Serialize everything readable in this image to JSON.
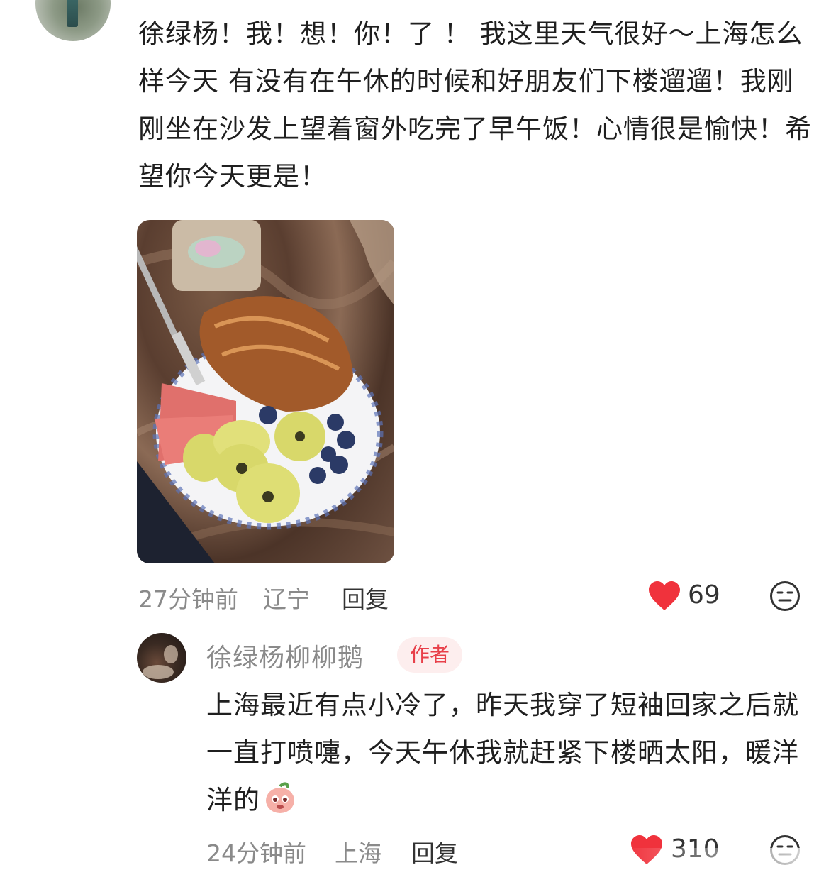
{
  "comment": {
    "text": "徐绿杨！我！想！你！了 ！ 我这里天气很好～上海怎么样今天 有没有在午休的时候和好朋友们下楼遛遛！我刚刚坐在沙发上望着窗外吃完了早午饭！心情很是愉快！希望你今天更是！",
    "time": "27分钟前",
    "location": "辽宁",
    "reply_label": "回复",
    "likes": "69",
    "photo_icon": "breakfast-photo",
    "like_icon": "heart-icon",
    "emoji_icon": "face-icon"
  },
  "reply": {
    "author": "徐绿杨柳柳鹅",
    "badge": "作者",
    "text": "上海最近有点小冷了，昨天我穿了短袖回家之后就一直打喷嚏，今天午休我就赶紧下楼晒太阳，暖洋洋的",
    "emoji": "peach-emoji",
    "time": "24分钟前",
    "location": "上海",
    "reply_label": "回复",
    "likes": "310"
  },
  "colors": {
    "heart": "#f0323c",
    "badge_text": "#e8404a",
    "badge_bg": "#fdeeee",
    "meta_text": "#8a8a8a"
  }
}
